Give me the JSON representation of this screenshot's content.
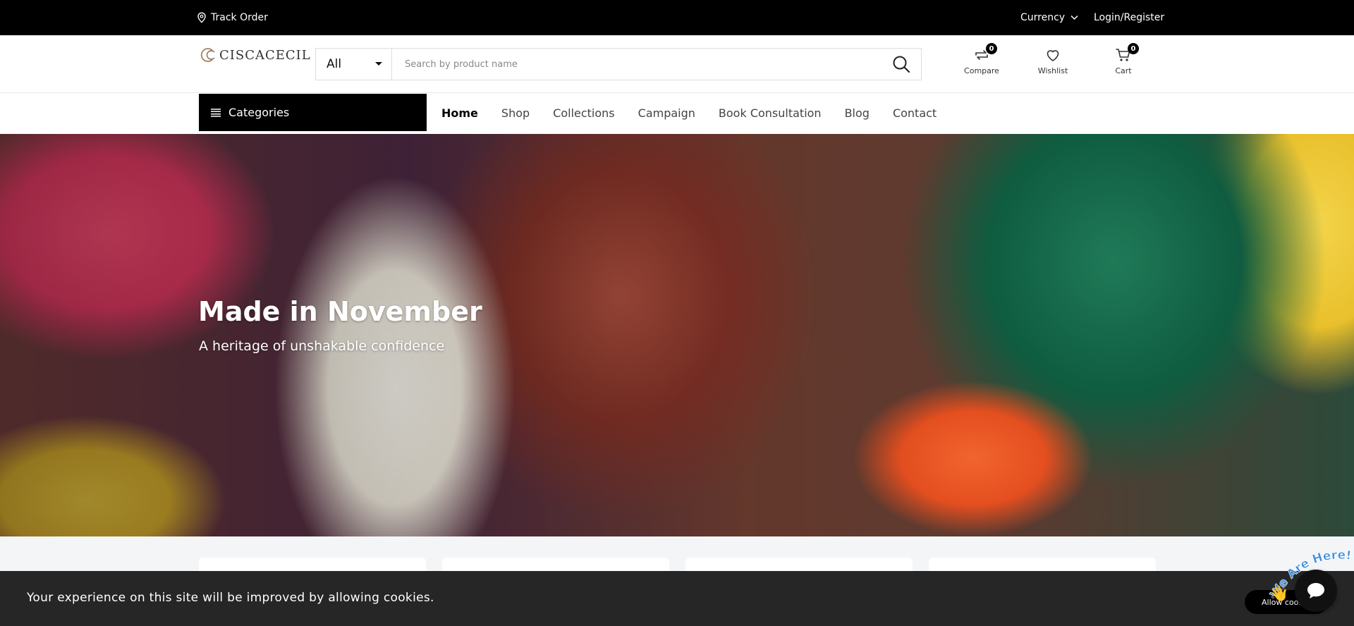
{
  "topbar": {
    "track_order": "Track Order",
    "currency": "Currency",
    "login": "Login/Register"
  },
  "header": {
    "logo_text": "CISCACECIL",
    "search": {
      "category": "All",
      "placeholder": "Search by product name"
    },
    "compare": {
      "label": "Compare",
      "count": "0"
    },
    "wishlist": {
      "label": "Wishlist"
    },
    "cart": {
      "label": "Cart",
      "count": "0"
    }
  },
  "nav": {
    "categories_label": "Categories",
    "items": [
      {
        "label": "Home",
        "active": true
      },
      {
        "label": "Shop"
      },
      {
        "label": "Collections"
      },
      {
        "label": "Campaign"
      },
      {
        "label": "Book Consultation"
      },
      {
        "label": "Blog"
      },
      {
        "label": "Contact"
      }
    ]
  },
  "hero": {
    "title": "Made in November",
    "subtitle": "A heritage of unshakable confidence"
  },
  "cookie": {
    "message": "Your experience on this site will be improved by allowing cookies.",
    "button": "Allow cookies"
  },
  "chat": {
    "badge_text": "We Are Here!"
  },
  "colors": {
    "topbar": "#000000",
    "cookie_bar": "#262626",
    "section_bg": "#f4f5f7"
  }
}
